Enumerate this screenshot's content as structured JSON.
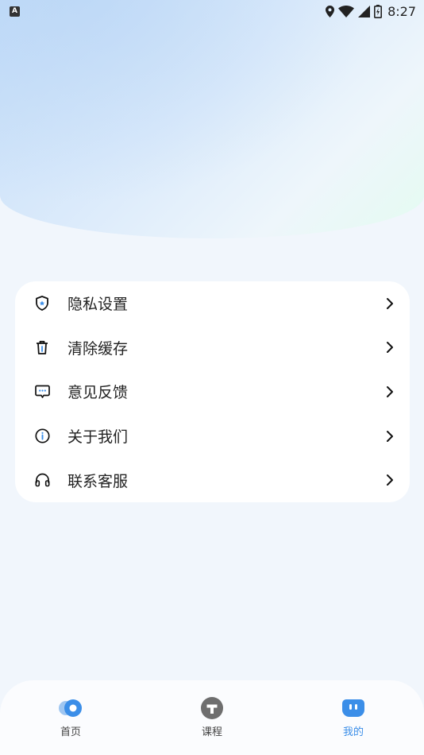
{
  "status_bar": {
    "left_badge": "A",
    "time": "8:27",
    "icons": [
      "location-icon",
      "wifi-icon",
      "signal-icon",
      "battery-icon"
    ]
  },
  "menu": {
    "items": [
      {
        "label": "隐私设置",
        "icon": "shield-icon"
      },
      {
        "label": "清除缓存",
        "icon": "trash-icon"
      },
      {
        "label": "意见反馈",
        "icon": "message-icon"
      },
      {
        "label": "关于我们",
        "icon": "info-icon"
      },
      {
        "label": "联系客服",
        "icon": "headset-icon"
      }
    ]
  },
  "tab_bar": {
    "tabs": [
      {
        "label": "首页",
        "icon": "home-icon",
        "active": false
      },
      {
        "label": "课程",
        "icon": "course-icon",
        "active": false
      },
      {
        "label": "我的",
        "icon": "profile-icon",
        "active": true
      }
    ],
    "active_color": "#3b8ee8"
  }
}
